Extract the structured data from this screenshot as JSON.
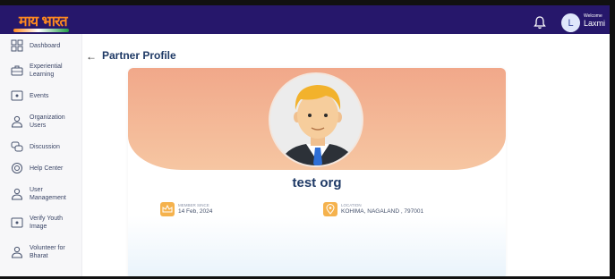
{
  "header": {
    "logo_text": "माय भारत",
    "welcome_label": "Welcome",
    "user_name": "Laxmi",
    "avatar_initial": "L"
  },
  "sidebar": {
    "items": [
      {
        "label": "Dashboard",
        "icon": "grid-icon"
      },
      {
        "label": "Experiential Learning",
        "icon": "briefcase-icon"
      },
      {
        "label": "Events",
        "icon": "event-icon"
      },
      {
        "label": "Organization Users",
        "icon": "user-icon"
      },
      {
        "label": "Discussion",
        "icon": "chat-icon"
      },
      {
        "label": "Help Center",
        "icon": "help-icon"
      },
      {
        "label": "User Management",
        "icon": "user-icon"
      },
      {
        "label": "Verify Youth Image",
        "icon": "image-icon"
      },
      {
        "label": "Volunteer for Bharat",
        "icon": "user-icon"
      }
    ]
  },
  "page": {
    "title": "Partner Profile"
  },
  "profile": {
    "org_name": "test org",
    "member_since_label": "MEMBER SINCE",
    "member_since_value": "14 Feb, 2024",
    "location_label": "LOCATION",
    "location_value": "KOHIMA, NAGALAND , 797001"
  },
  "colors": {
    "topbar": "#26176b",
    "banner": "#f1a88a",
    "title": "#1f3a66",
    "accent": "#f5b24d"
  }
}
